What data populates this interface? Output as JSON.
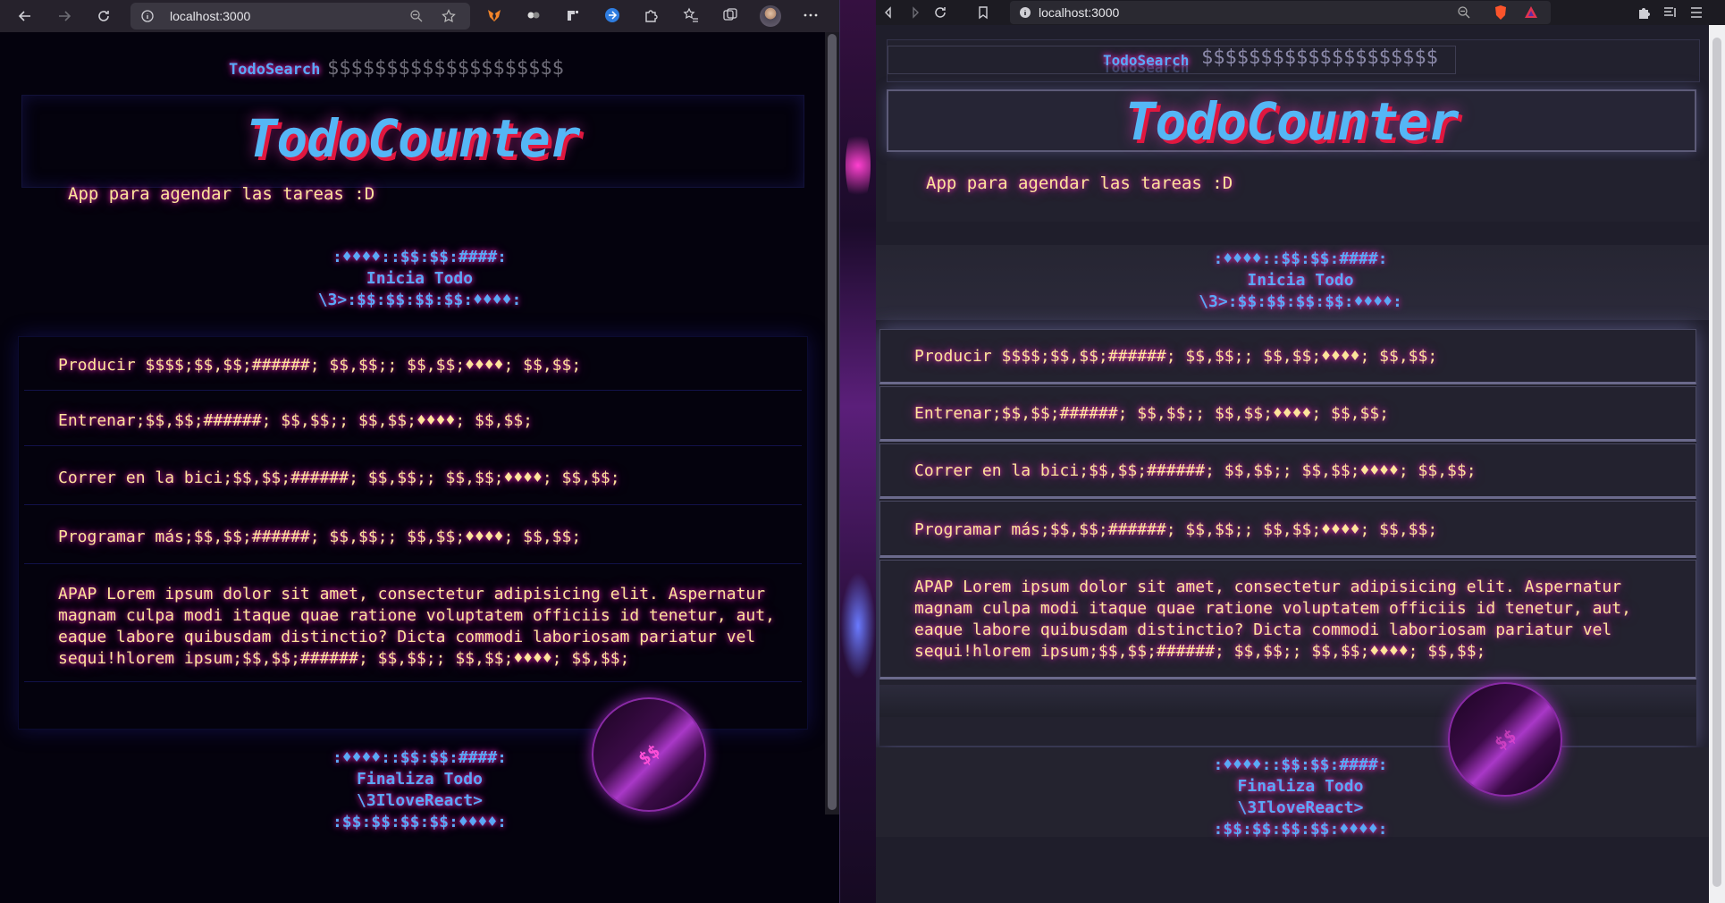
{
  "browser": {
    "address": "localhost:3000"
  },
  "app": {
    "search_label": "TodoSearch",
    "search_value": "$$$$$$$$$$$$$$$$$$$$",
    "search_ghost": "TodoSearch",
    "title": "TodoCounter",
    "subtitle": "App para agendar las tareas :D",
    "header_lines": [
      ":♦♦♦♦::$$:$$:####:",
      "Inicia Todo",
      "\\3>:$$:$$:$$:$$:♦♦♦♦:"
    ],
    "todos": [
      "Producir $$$$;$$,$$;######; $$,$$;; $$,$$;♦♦♦♦; $$,$$;",
      "Entrenar;$$,$$;######; $$,$$;; $$,$$;♦♦♦♦; $$,$$;",
      "Correr en la bici;$$,$$;######; $$,$$;; $$,$$;♦♦♦♦; $$,$$;",
      "Programar más;$$,$$;######; $$,$$;; $$,$$;♦♦♦♦; $$,$$;"
    ],
    "todo_long_left": [
      "APAP Lorem ipsum dolor sit amet, consectetur adipisicing elit. Aspernatur",
      "magnam culpa modi itaque quae ratione voluptatem officiis id tenetur, aut,",
      "eaque labore quibusdam distinctio? Dicta commodi laboriosam pariatur vel",
      "sequi!hlorem ipsum;$$,$$;######; $$,$$;; $$,$$;♦♦♦♦; $$,$$;"
    ],
    "footer_lines": [
      ":♦♦♦♦::$$:$$:####:",
      "Finaliza Todo",
      "\\3IloveReact>",
      ":$$:$$:$$:$$:♦♦♦♦:"
    ],
    "fab_label": "$$"
  },
  "colors": {
    "title_blue": "#55b6f5",
    "shadow_red": "#e0173f",
    "text_yellow": "#fde49a",
    "glow_pink": "#ff2ac0"
  },
  "icons": {
    "left_toolbar": [
      "back-icon",
      "forward-icon",
      "refresh-icon",
      "info-icon",
      "zoom-icon",
      "star-add-icon",
      "metamask-icon",
      "extension-icon",
      "extension-icon",
      "sync-icon",
      "puzzle-icon",
      "favorites-icon",
      "collections-icon",
      "profile-avatar",
      "more-icon"
    ],
    "right_toolbar": [
      "back-icon",
      "forward-icon",
      "refresh-icon",
      "bookmark-icon",
      "info-icon",
      "zoom-icon",
      "brave-shield-icon",
      "brave-rewards-icon",
      "puzzle-icon",
      "menu-icon"
    ]
  }
}
